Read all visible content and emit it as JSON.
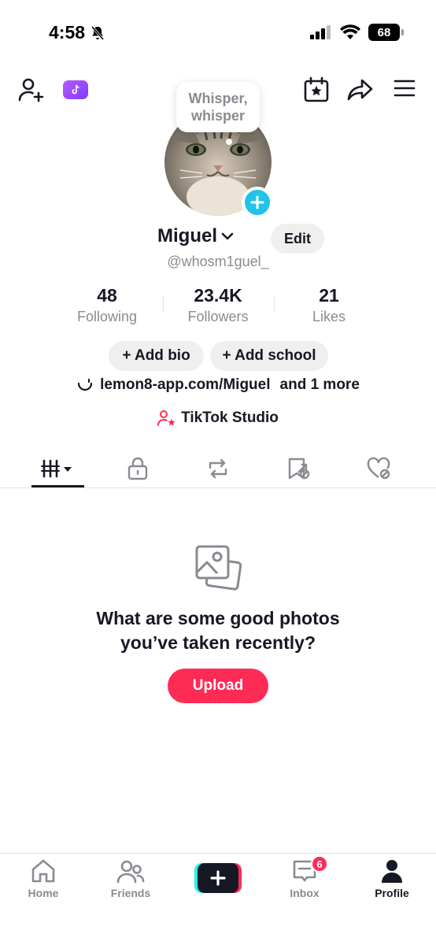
{
  "status_bar": {
    "time": "4:58",
    "battery": "68"
  },
  "profile": {
    "bubble_text": "Whisper, whisper",
    "name": "Miguel",
    "edit_label": "Edit",
    "handle": "@whosm1guel_",
    "stats": [
      {
        "value": "48",
        "label": "Following"
      },
      {
        "value": "23.4K",
        "label": "Followers"
      },
      {
        "value": "21",
        "label": "Likes"
      }
    ],
    "add_bio_label": "+ Add bio",
    "add_school_label": "+ Add school",
    "link_text": "lemon8-app.com/Miguel",
    "link_more": "and 1 more",
    "studio_label": "TikTok Studio"
  },
  "tabs": [
    {
      "icon": "grid-icon",
      "active": true
    },
    {
      "icon": "lock-icon",
      "active": false
    },
    {
      "icon": "repost-icon",
      "active": false
    },
    {
      "icon": "favorites-icon",
      "active": false
    },
    {
      "icon": "liked-icon",
      "active": false
    }
  ],
  "empty_state": {
    "line1": "What are some good photos",
    "line2": "you’ve taken recently?",
    "upload_label": "Upload"
  },
  "bottom_nav": {
    "home": "Home",
    "friends": "Friends",
    "inbox": "Inbox",
    "inbox_badge": "6",
    "profile": "Profile"
  },
  "colors": {
    "accent": "#fe2c55",
    "cyan": "#25f4ee",
    "badge_blue": "#20c4e8",
    "text": "#161823",
    "muted": "#8a8b91"
  }
}
